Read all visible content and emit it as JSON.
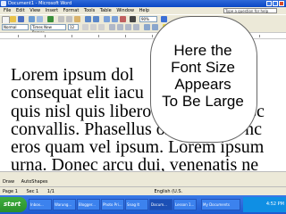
{
  "window": {
    "title": "Document1 - Microsoft Word"
  },
  "menu": {
    "items": [
      "File",
      "Edit",
      "View",
      "Insert",
      "Format",
      "Tools",
      "Table",
      "Window",
      "Help"
    ],
    "help_hint": "Type a question for help"
  },
  "toolbar": {
    "zoom": "90%",
    "style": "Normal",
    "font": "Times New Roman",
    "font_size": "12"
  },
  "document": {
    "lines": [
      "Lorem ipsum dol",
      "consequat elit iacu",
      "quis nisl quis libero pellentesque sc",
      "convallis. Phasellus ornare, ante nc",
      "eros quam vel ipsum. Lorem ipsum",
      "urna. Donec arcu dui, venenatis ne"
    ]
  },
  "callout": {
    "lines": [
      "Here the",
      "Font Size",
      "Appears",
      "To Be Large"
    ]
  },
  "drawing_toolbar": {
    "draw": "Draw",
    "autoshapes": "AutoShapes"
  },
  "status": {
    "page": "Page 1",
    "sec": "Sec 1",
    "pages": "1/1",
    "language": "English (U.S."
  },
  "taskbar": {
    "start": "start",
    "tasks": [
      "Inbox...",
      "Warung...",
      "Blogger...",
      "Photo Pri...",
      "Snag It",
      "Docum...",
      "Lesson 1..."
    ],
    "tray_label": "My Documents",
    "clock": "4:52 PM"
  }
}
